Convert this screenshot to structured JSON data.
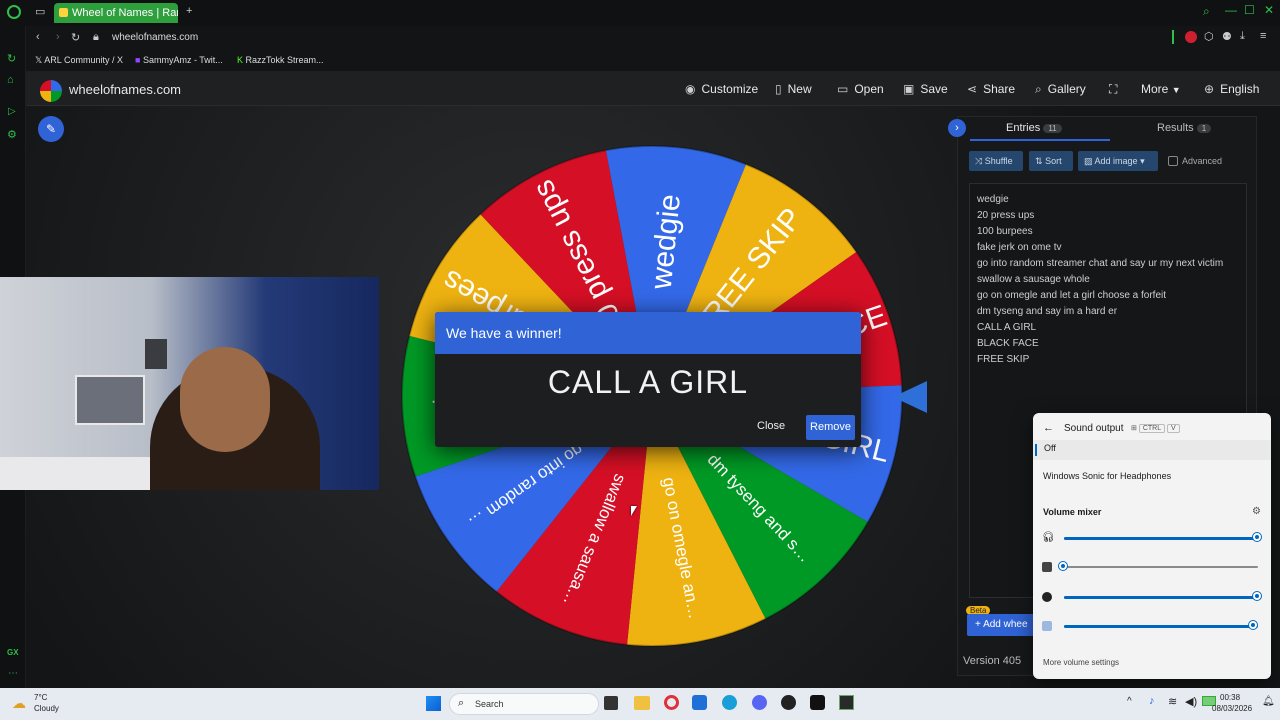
{
  "browser": {
    "tab_title": "Wheel of Names | Random",
    "url": "wheelofnames.com",
    "bookmarks": [
      "ARL Community / X",
      "SammyAmz - Twit...",
      "RazzTokk Stream..."
    ]
  },
  "site": {
    "logo_text": "wheelofnames.com",
    "nav": [
      "Customize",
      "New",
      "Open",
      "Save",
      "Share",
      "Gallery",
      "More",
      "English"
    ]
  },
  "wheel": {
    "segments": [
      {
        "label": "wedgie",
        "color": "#3369e8"
      },
      {
        "label": "FREE SKIP",
        "color": "#eeb211"
      },
      {
        "label": "BLACK FACE",
        "color": "#d50f25"
      },
      {
        "label": "CALL A GIRL",
        "color": "#3369e8"
      },
      {
        "label": "dm tyseng and say im a hard er",
        "color": "#009925"
      },
      {
        "label": "go on omegle and let a girl choose a forfeit",
        "color": "#eeb211"
      },
      {
        "label": "swallow a sausage whole",
        "color": "#d50f25"
      },
      {
        "label": "go into random streamer chat and say ur my next victim",
        "color": "#3369e8"
      },
      {
        "label": "fake jerk on ome tv",
        "color": "#009925"
      },
      {
        "label": "100 burpees",
        "color": "#eeb211"
      },
      {
        "label": "20 press ups",
        "color": "#d50f25"
      }
    ]
  },
  "dialog": {
    "title": "We have a winner!",
    "winner": "CALL A GIRL",
    "close": "Close",
    "remove": "Remove"
  },
  "panel": {
    "tab_entries": "Entries",
    "entries_count": "11",
    "tab_results": "Results",
    "results_count": "1",
    "shuffle": "Shuffle",
    "sort": "Sort",
    "add_image": "Add image",
    "advanced": "Advanced",
    "entries": [
      "wedgie",
      "20 press ups",
      "100 burpees",
      "fake jerk on ome tv",
      "go into random streamer chat and say ur my next victim",
      "swallow a sausage whole",
      "go on omegle and let a girl choose a forfeit",
      "dm tyseng and say im a hard er",
      "CALL A GIRL",
      "BLACK FACE",
      "FREE SKIP"
    ],
    "beta": "Beta",
    "add_wheel": "Add whee",
    "version": "Version 405"
  },
  "sound": {
    "title": "Sound output",
    "shortcut_ctrl": "CTRL",
    "shortcut_v": "V",
    "off_item": "Off",
    "device": "Windows Sonic for Headphones",
    "mixer_title": "Volume mixer",
    "more": "More volume settings",
    "levels": [
      1.0,
      0.0,
      1.0,
      0.98
    ]
  },
  "taskbar": {
    "temp": "7°C",
    "weather": "Cloudy",
    "search": "Search",
    "time": "00:38",
    "date": "08/03/2026"
  }
}
